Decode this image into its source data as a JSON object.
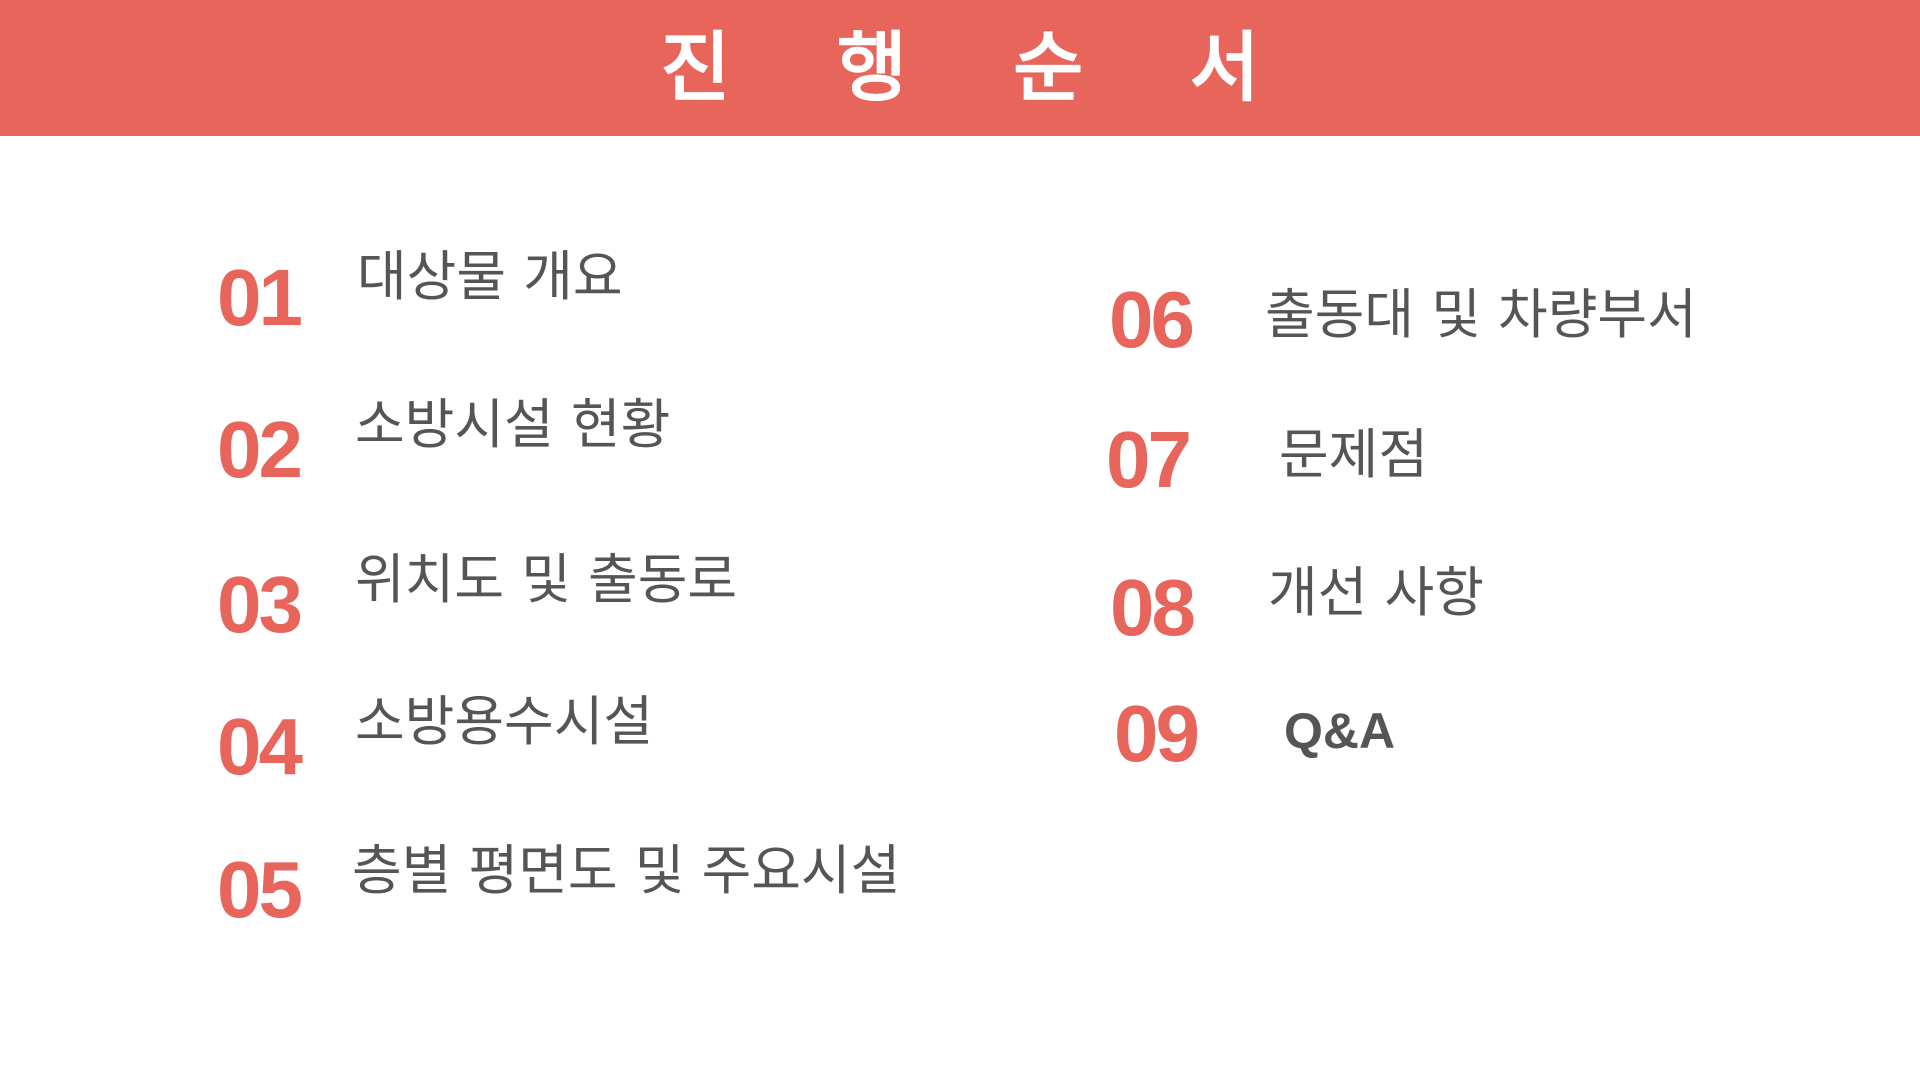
{
  "header": {
    "title": "진 행 순 서"
  },
  "colors": {
    "accent": "#e8655c",
    "text": "#555555",
    "background": "#ffffff"
  },
  "toc": {
    "items": [
      {
        "number": "01",
        "label": "대상물 개요"
      },
      {
        "number": "02",
        "label": "소방시설 현황"
      },
      {
        "number": "03",
        "label": "위치도 및 출동로"
      },
      {
        "number": "04",
        "label": "소방용수시설"
      },
      {
        "number": "05",
        "label": "층별 평면도 및 주요시설"
      },
      {
        "number": "06",
        "label": "출동대 및 차량부서"
      },
      {
        "number": "07",
        "label": "문제점"
      },
      {
        "number": "08",
        "label": "개선 사항"
      },
      {
        "number": "09",
        "label": "Q&A"
      }
    ]
  }
}
